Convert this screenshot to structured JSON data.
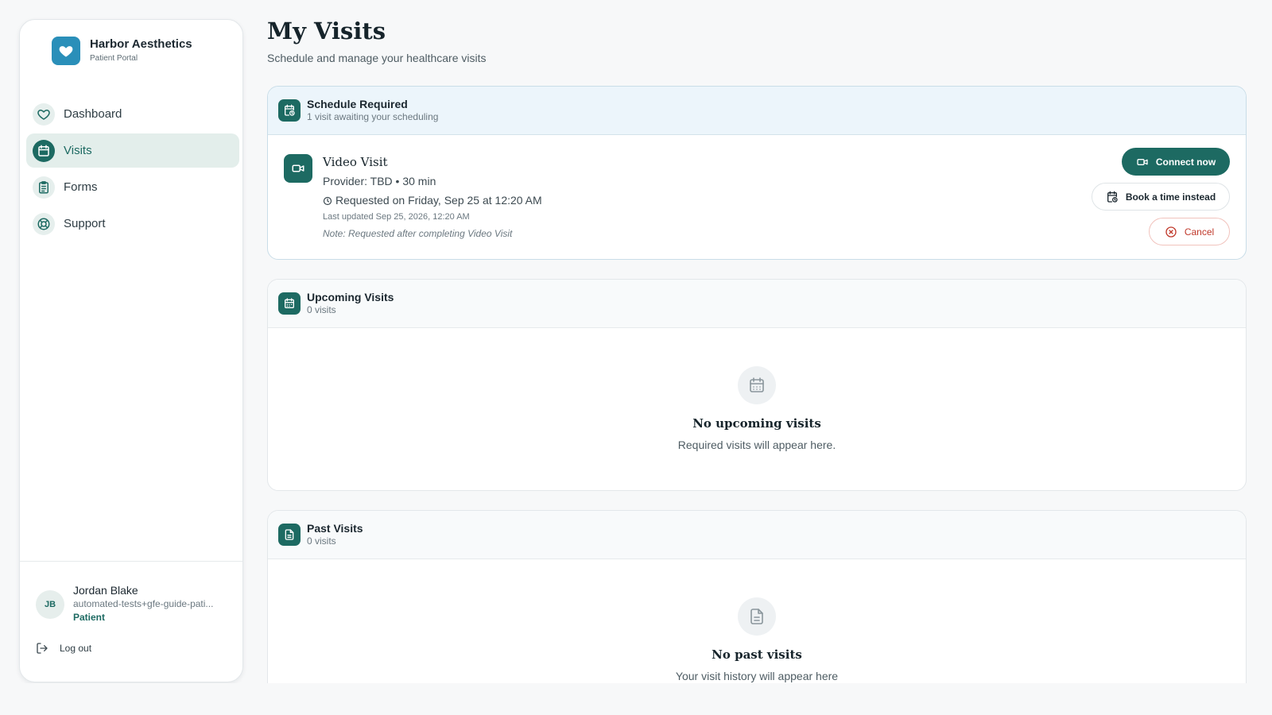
{
  "brand": {
    "name": "Harbor Aesthetics",
    "subtitle": "Patient Portal",
    "logo_icon": "heart-icon",
    "color": "#2a8fb9"
  },
  "nav": {
    "items": [
      {
        "label": "Dashboard",
        "icon": "heart-icon",
        "active": false
      },
      {
        "label": "Visits",
        "icon": "calendar-icon",
        "active": true
      },
      {
        "label": "Forms",
        "icon": "clipboard-icon",
        "active": false
      },
      {
        "label": "Support",
        "icon": "lifebuoy-icon",
        "active": false
      }
    ]
  },
  "user": {
    "initials": "JB",
    "name": "Jordan Blake",
    "email": "automated-tests+gfe-guide-pati...",
    "role": "Patient",
    "logout_label": "Log out"
  },
  "page": {
    "title": "My Visits",
    "subtitle": "Schedule and manage your healthcare visits"
  },
  "schedule_required": {
    "title": "Schedule Required",
    "subtitle": "1 visit awaiting your scheduling",
    "visit": {
      "title": "Video Visit",
      "provider": "Provider: TBD • 30 min",
      "requested": "Requested on Friday, Sep 25 at 12:20 AM",
      "updated": "Last updated Sep 25, 2026, 12:20 AM",
      "note": "Note: Requested after completing Video Visit"
    },
    "actions": {
      "connect_label": "Connect now",
      "book_label": "Book a time instead",
      "cancel_label": "Cancel"
    }
  },
  "upcoming": {
    "title": "Upcoming Visits",
    "subtitle": "0 visits",
    "empty_title": "No upcoming visits",
    "empty_sub": "Required visits will appear here."
  },
  "past": {
    "title": "Past Visits",
    "subtitle": "0 visits",
    "empty_title": "No past visits",
    "empty_sub": "Your visit history will appear here"
  },
  "colors": {
    "accent": "#1d6a62",
    "danger": "#c0392b",
    "background": "#f7f8f9"
  }
}
